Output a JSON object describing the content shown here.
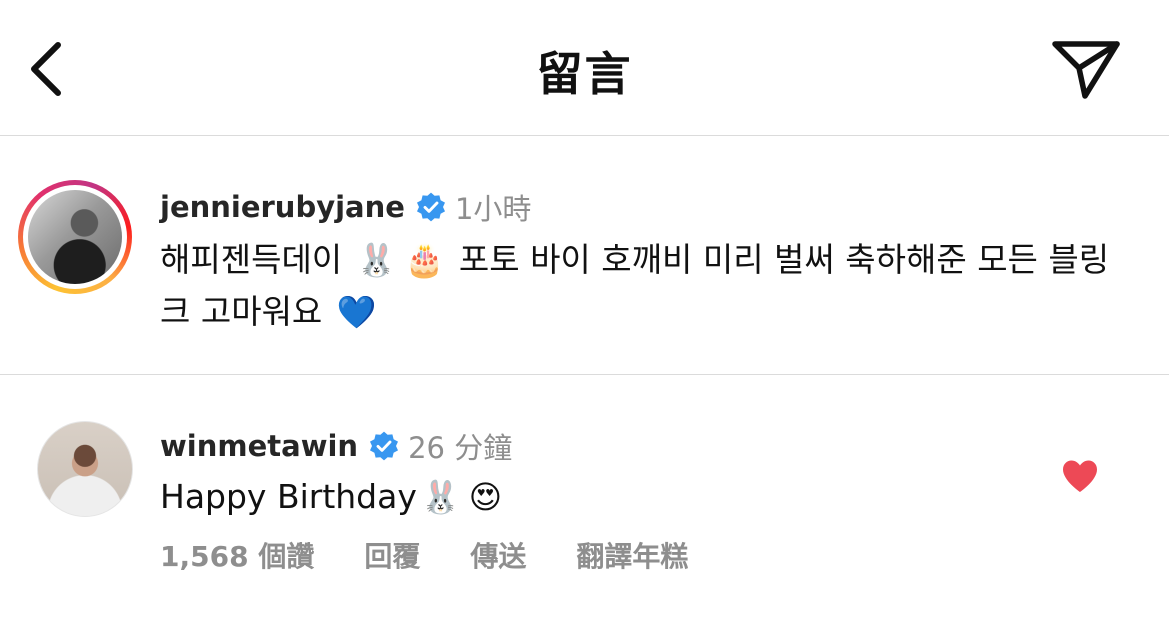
{
  "header": {
    "title": "留言",
    "back_icon": "chevron-left-icon",
    "share_icon": "paper-plane-icon"
  },
  "comments": [
    {
      "username": "jennierubyjane",
      "verified": true,
      "time": "1小時",
      "text_parts": [
        "해피젠득데이",
        "🐰",
        "🎂",
        "포토 바이 호깨비 미리 벌써 축하해준 모든 블링크 고마워요",
        "💙"
      ],
      "story_ring": true
    },
    {
      "username": "winmetawin",
      "verified": true,
      "time": "26 分鐘",
      "text_parts": [
        "Happy Birthday",
        "🐰",
        "😍"
      ],
      "liked": true,
      "actions": {
        "likes": "1,568 個讚",
        "reply": "回覆",
        "send": "傳送",
        "translate": "翻譯年糕"
      }
    }
  ],
  "colors": {
    "verified_blue": "#3897f0",
    "like_red": "#ed4956",
    "secondary_text": "#8e8e8e",
    "divider": "#dbdbdb"
  }
}
